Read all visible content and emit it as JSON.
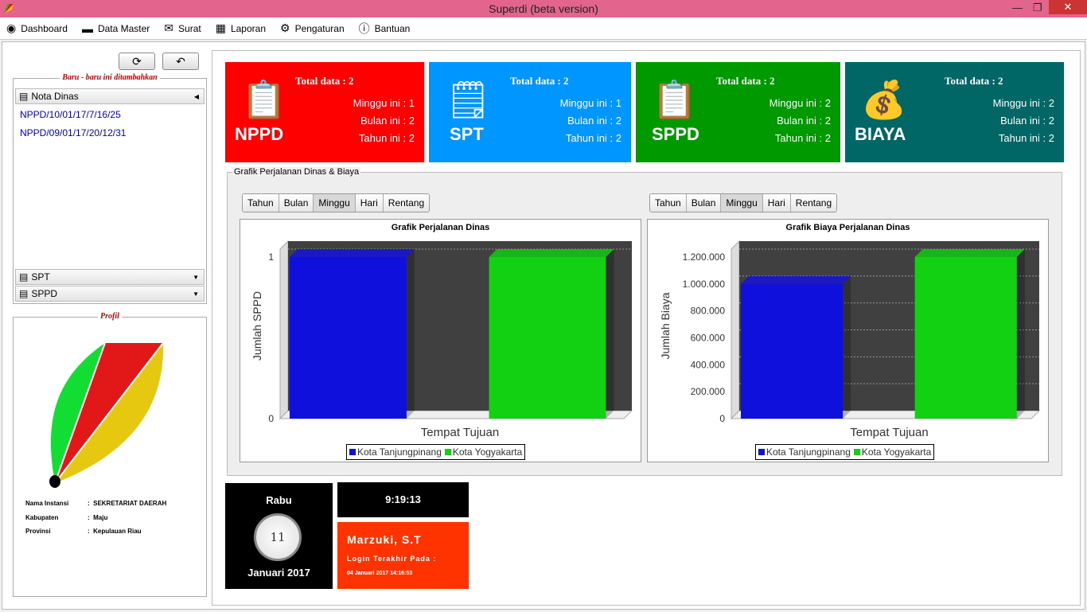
{
  "window": {
    "title": "Superdi (beta version)",
    "controls": [
      "minimize",
      "restore",
      "close"
    ]
  },
  "menu": [
    {
      "label": "Dashboard",
      "icon": "dashboard-icon"
    },
    {
      "label": "Data Master",
      "icon": "drive-icon"
    },
    {
      "label": "Surat",
      "icon": "mail-icon"
    },
    {
      "label": "Laporan",
      "icon": "report-icon"
    },
    {
      "label": "Pengaturan",
      "icon": "gear-icon"
    },
    {
      "label": "Bantuan",
      "icon": "help-icon"
    }
  ],
  "recent": {
    "title": "Baru - baru ini ditambahkan",
    "sections": [
      "Nota Dinas",
      "SPT",
      "SPPD"
    ],
    "items": [
      "NPPD/10/01/17/7/16/25",
      "NPPD/09/01/17/20/12/31"
    ]
  },
  "profile": {
    "title": "Profil",
    "rows": [
      {
        "label": "Nama Instansi",
        "value": "SEKRETARIAT DAERAH"
      },
      {
        "label": "Kabupaten",
        "value": "Maju"
      },
      {
        "label": "Provinsi",
        "value": "Kepulauan Riau"
      }
    ]
  },
  "cards": [
    {
      "name": "NPPD",
      "total": "Total data : 2",
      "week": "Minggu ini : 1",
      "month": "Bulan ini : 2",
      "year": "Tahun ini : 2",
      "color": "#ff0000"
    },
    {
      "name": "SPT",
      "total": "Total data : 2",
      "week": "Minggu ini : 1",
      "month": "Bulan ini : 2",
      "year": "Tahun ini : 2",
      "color": "#0096ff"
    },
    {
      "name": "SPPD",
      "total": "Total data : 2",
      "week": "Minggu ini : 2",
      "month": "Bulan ini : 2",
      "year": "Tahun ini : 2",
      "color": "#009900"
    },
    {
      "name": "BIAYA",
      "total": "Total data : 2",
      "week": "Minggu ini : 2",
      "month": "Bulan ini : 2",
      "year": "Tahun ini : 2",
      "color": "#006666"
    }
  ],
  "chart_section": {
    "title": "Grafik Perjalanan Dinas & Biaya",
    "tabs": [
      "Tahun",
      "Bulan",
      "Minggu",
      "Hari",
      "Rentang"
    ],
    "active_tab": "Minggu"
  },
  "chart_data": [
    {
      "type": "bar",
      "title": "Grafik Perjalanan Dinas",
      "xlabel": "Tempat Tujuan",
      "ylabel": "Jumlah SPPD",
      "categories": [
        "Kota Tanjungpinang",
        "Kota Yogyakarta"
      ],
      "values": [
        1,
        1
      ],
      "ylim": [
        0,
        1
      ],
      "yticks": [
        "0",
        "1"
      ],
      "colors": [
        "#1010dd",
        "#12d012"
      ],
      "legend": "bottom"
    },
    {
      "type": "bar",
      "title": "Grafik Biaya Perjalanan Dinas",
      "xlabel": "Tempat Tujuan",
      "ylabel": "Jumlah Biaya",
      "categories": [
        "Kota Tanjungpinang",
        "Kota Yogyakarta"
      ],
      "values": [
        1000000,
        1200000
      ],
      "ylim": [
        0,
        1200000
      ],
      "yticks": [
        "0",
        "200.000",
        "400.000",
        "600.000",
        "800.000",
        "1.000.000",
        "1.200.000"
      ],
      "colors": [
        "#1010dd",
        "#12d012"
      ],
      "legend": "bottom"
    }
  ],
  "calendar": {
    "day": "Rabu",
    "date": "11",
    "month_year": "Januari 2017"
  },
  "clock": {
    "time": "9:19:13"
  },
  "user": {
    "name": "Marzuki, S.T",
    "last_login_label": "Login Terakhir Pada :",
    "last_login": "04 Januari 2017 14:16:53"
  }
}
